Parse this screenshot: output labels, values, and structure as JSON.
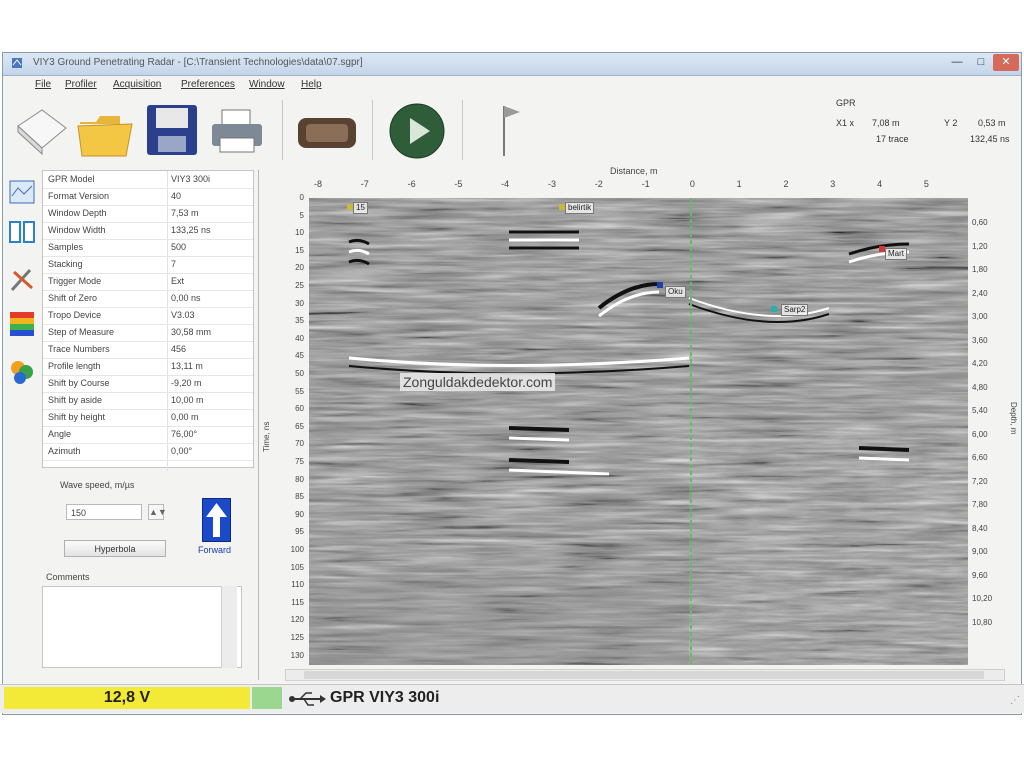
{
  "window": {
    "title": "VIY3 Ground Penetrating Radar - [C:\\Transient Technologies\\data\\07.sgpr]",
    "min_glyph": "—",
    "max_glyph": "□",
    "close_glyph": "✕"
  },
  "menu": [
    "File",
    "Profiler",
    "Acquisition",
    "Preferences",
    "Window",
    "Help"
  ],
  "toolbar": {
    "icons": [
      "new-document-icon",
      "open-folder-icon",
      "save-floppy-icon",
      "print-icon",
      "radar-device-icon",
      "play-icon",
      "flag-icon"
    ]
  },
  "cursor_info": {
    "label": "GPR",
    "x_label": "X1 x",
    "x_value": "7,08 m",
    "trace_value": "17 trace",
    "y_label": "Y 2",
    "y_value1": "0,53 m",
    "y_value2": "132,45 ns"
  },
  "properties": [
    {
      "key": "GPR Model",
      "value": "VIY3 300i"
    },
    {
      "key": "Format Version",
      "value": "40"
    },
    {
      "key": "Window Depth",
      "value": "7,53 m"
    },
    {
      "key": "Window Width",
      "value": "133,25 ns"
    },
    {
      "key": "Samples",
      "value": "500"
    },
    {
      "key": "Stacking",
      "value": "7"
    },
    {
      "key": "Trigger Mode",
      "value": "Ext"
    },
    {
      "key": "Shift of Zero",
      "value": "0,00 ns"
    },
    {
      "key": "Tropo Device",
      "value": "V3.03"
    },
    {
      "key": "Step of Measure",
      "value": "30,58 mm"
    },
    {
      "key": "Trace Numbers",
      "value": "456"
    },
    {
      "key": "Profile length",
      "value": "13,11 m"
    },
    {
      "key": "Shift by Course",
      "value": "-9,20 m"
    },
    {
      "key": "Shift by aside",
      "value": "10,00 m"
    },
    {
      "key": "Shift by height",
      "value": "0,00 m"
    },
    {
      "key": "Angle",
      "value": "76,00°"
    },
    {
      "key": "Azimuth",
      "value": "0,00°"
    }
  ],
  "wave_speed": {
    "label": "Wave speed, m/µs",
    "value": "150",
    "spin_glyph": "▲▼"
  },
  "buttons": {
    "hyperbola": "Hyperbola",
    "forward": "Forward"
  },
  "comments_label": "Comments",
  "plot": {
    "distance_label": "Distance, m",
    "x_ticks": [
      "-8",
      "-7",
      "-6",
      "-5",
      "-4",
      "-3",
      "-2",
      "-1",
      "0",
      "1",
      "2",
      "3",
      "4",
      "5"
    ],
    "time_label": "Time, ns",
    "time_ticks": [
      "0",
      "5",
      "10",
      "15",
      "20",
      "25",
      "30",
      "35",
      "40",
      "45",
      "50",
      "55",
      "60",
      "65",
      "70",
      "75",
      "80",
      "85",
      "90",
      "95",
      "100",
      "105",
      "110",
      "115",
      "120",
      "125",
      "130"
    ],
    "depth_label": "Depth, m",
    "depth_ticks": [
      "0,60",
      "1,20",
      "1,80",
      "2,40",
      "3,00",
      "3,60",
      "4,20",
      "4,80",
      "5,40",
      "6,00",
      "6,60",
      "7,20",
      "7,80",
      "8,40",
      "9,00",
      "9,60",
      "10,20",
      "10,80"
    ],
    "markers": [
      {
        "label": "15",
        "color": "#c9b93a"
      },
      {
        "label": "belirtik",
        "color": "#c9b93a"
      },
      {
        "label": "Oku",
        "color": "#1f3fa8"
      },
      {
        "label": "Mart",
        "color": "#d33636"
      },
      {
        "label": "Sarp2",
        "color": "#27b0b0"
      }
    ],
    "cursor_color": "#5fbf5f"
  },
  "watermark": "Zonguldakdedektor.com",
  "status": {
    "battery": "12,8 V",
    "battery_color": "#f2ea37",
    "device": "GPR VIY3 300i"
  }
}
